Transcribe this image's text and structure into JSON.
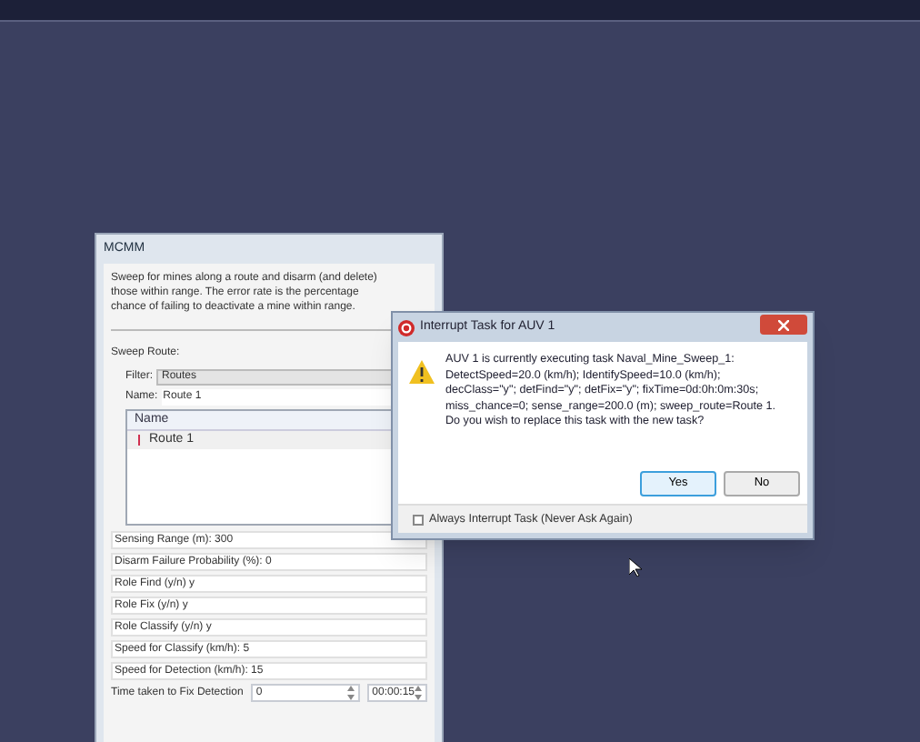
{
  "panel": {
    "title": "MCMM",
    "description": "Sweep for mines along a route and disarm (and delete) those within range. The error rate is the percentage chance of failing to deactivate a mine within range.",
    "section": "Sweep Route:",
    "filter": {
      "label": "Filter:",
      "value": "Routes"
    },
    "name": {
      "label": "Name:",
      "value": "Route 1"
    },
    "list": {
      "column": "Name",
      "rows": [
        {
          "label": "Route 1"
        }
      ]
    },
    "fields": [
      {
        "kind": "text",
        "label": "Sensing Range (m): 300"
      },
      {
        "kind": "text",
        "label": "Disarm Failure Probability (%): 0"
      },
      {
        "kind": "text",
        "label": "Role Find (y/n) y"
      },
      {
        "kind": "text",
        "label": "Role Fix (y/n) y"
      },
      {
        "kind": "text",
        "label": "Role Classify (y/n) y"
      },
      {
        "kind": "text",
        "label": "Speed for Classify (km/h): 5"
      },
      {
        "kind": "text",
        "label": "Speed for Detection (km/h): 15"
      },
      {
        "kind": "spin",
        "label": "Time taken to Fix Detection",
        "value": "0",
        "time": "00:00:15"
      }
    ]
  },
  "dialog": {
    "title": "Interrupt Task for AUV 1",
    "message": [
      "AUV 1 is currently executing task Naval_Mine_Sweep_1:",
      "DetectSpeed=20.0 (km/h); IdentifySpeed=10.0 (km/h);",
      "decClass=\"y\"; detFind=\"y\"; detFix=\"y\"; fixTime=0d:0h:0m:30s;",
      "miss_chance=0; sense_range=200.0 (m); sweep_route=Route 1.",
      "Do you wish to replace this task with the new task?"
    ],
    "buttons": [
      {
        "label": "Yes",
        "selected": true
      },
      {
        "label": "No",
        "selected": false
      }
    ],
    "checkbox": {
      "label": "Always Interrupt Task (Never Ask Again)",
      "checked": false
    }
  }
}
